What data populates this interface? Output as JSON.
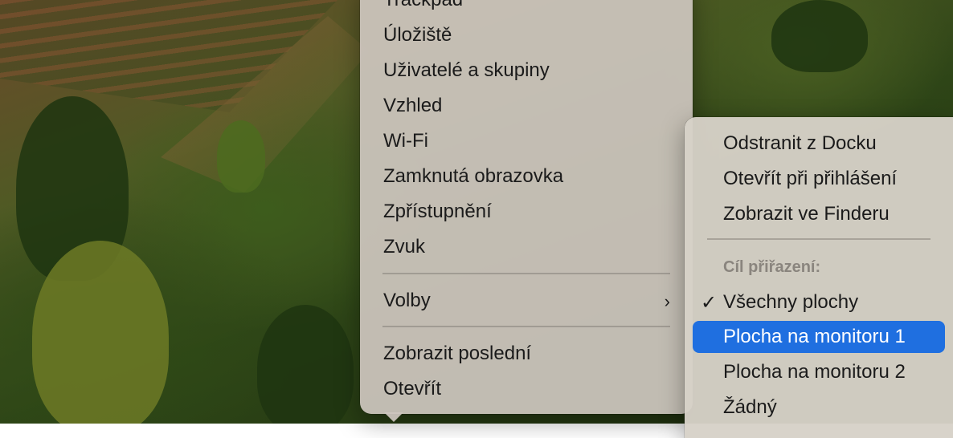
{
  "left_menu": {
    "items": [
      {
        "label": "Trackpad"
      },
      {
        "label": "Úložiště"
      },
      {
        "label": "Uživatelé a skupiny"
      },
      {
        "label": "Vzhled"
      },
      {
        "label": "Wi-Fi"
      },
      {
        "label": "Zamknutá obrazovka"
      },
      {
        "label": "Zpřístupnění"
      },
      {
        "label": "Zvuk"
      }
    ],
    "options_label": "Volby",
    "options_chevron": "›",
    "show_recent_label": "Zobrazit poslední",
    "open_label": "Otevřít"
  },
  "right_menu": {
    "remove_from_dock": "Odstranit z Docku",
    "open_at_login": "Otevřít při přihlášení",
    "show_in_finder": "Zobrazit ve Finderu",
    "assign_to_label": "Cíl přiřazení:",
    "check_mark": "✓",
    "assign_options": [
      {
        "label": "Všechny plochy",
        "checked": true
      },
      {
        "label": "Plocha na monitoru 1",
        "highlighted": true
      },
      {
        "label": "Plocha na monitoru 2"
      },
      {
        "label": "Žádný"
      }
    ]
  },
  "colors": {
    "highlight": "#1f6fe0",
    "menu_bg": "#cdc6be",
    "section_label": "#8a857e"
  },
  "icons": [
    "chevron-right-icon",
    "checkmark-icon"
  ]
}
